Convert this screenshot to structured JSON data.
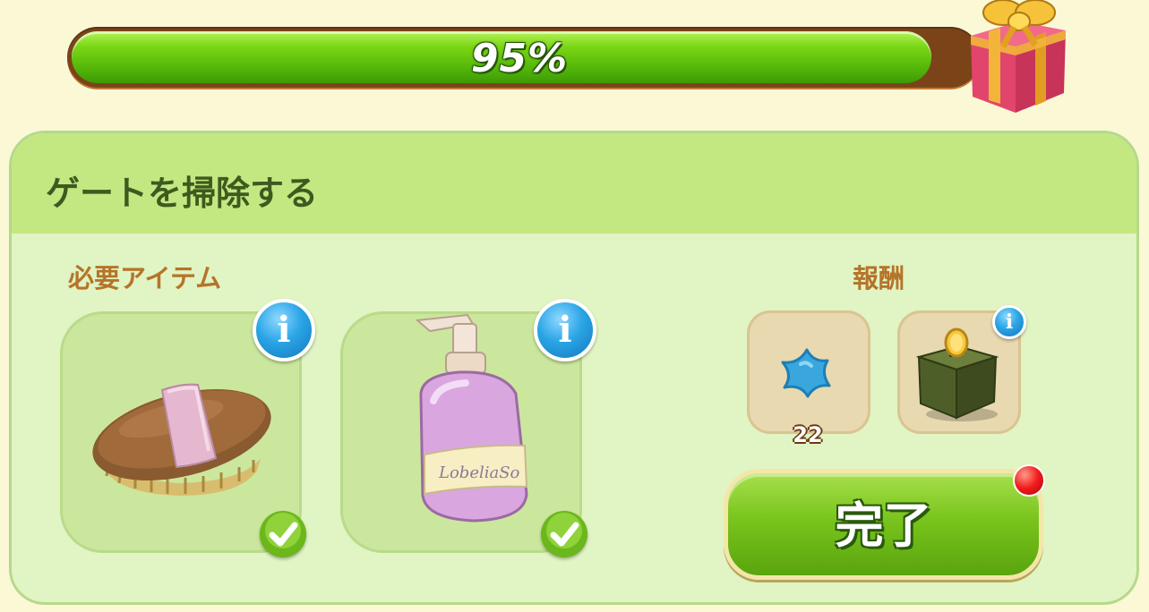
{
  "progress": {
    "percent_label": "95%",
    "value": 0.95
  },
  "task": {
    "title": "ゲートを掃除する"
  },
  "required": {
    "label": "必要アイテム",
    "items": [
      {
        "name": "brush",
        "icon": "brush-icon",
        "collected": true
      },
      {
        "name": "soap-bottle",
        "icon": "soap-bottle-icon",
        "bottle_text": "LobeliaSo",
        "collected": true
      }
    ]
  },
  "rewards": {
    "label": "報酬",
    "items": [
      {
        "icon": "blue-star-icon",
        "count": "22"
      },
      {
        "icon": "coin-box-icon"
      }
    ]
  },
  "complete_button": {
    "label": "完了"
  },
  "info_glyph": "i",
  "colors": {
    "accent_green": "#6bbf1a",
    "label_brown": "#b57429",
    "title_green": "#3f5a1e"
  }
}
